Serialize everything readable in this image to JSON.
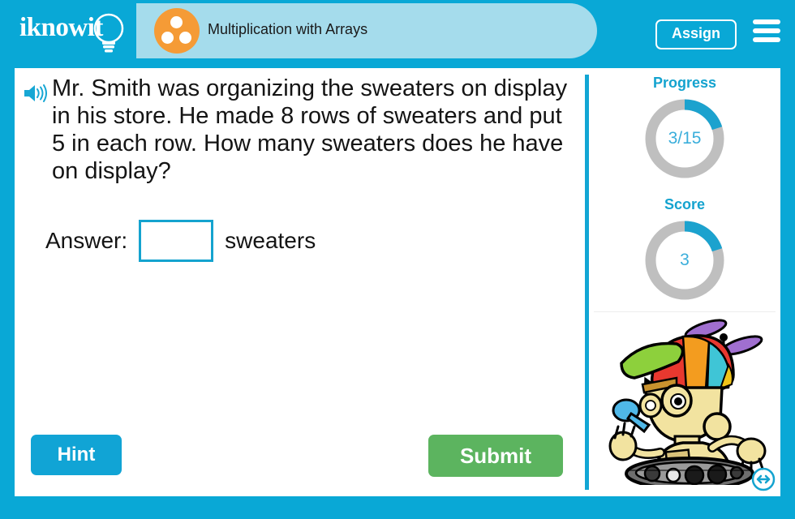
{
  "header": {
    "logo_text": "iknowit",
    "logo_icon": "lightbulb-icon",
    "subject_icon": "three-dots-array-icon",
    "lesson_title": "Multiplication with Arrays",
    "assign_label": "Assign",
    "menu_icon": "hamburger-menu-icon"
  },
  "question": {
    "audio_icon": "speaker-icon",
    "text": "Mr. Smith was organizing the sweaters on display in his store. He made 8 rows of sweaters and put 5 in each row. How many sweaters does he have on display?",
    "answer_label": "Answer:",
    "answer_value": "",
    "answer_placeholder": "",
    "answer_unit": "sweaters"
  },
  "actions": {
    "hint_label": "Hint",
    "submit_label": "Submit"
  },
  "side_panel": {
    "progress": {
      "label": "Progress",
      "value_text": "3/15",
      "current": 3,
      "total": 15,
      "percent": 20
    },
    "score": {
      "label": "Score",
      "value_text": "3",
      "current": 3,
      "percent": 20
    },
    "mascot_icon": "robot-mascot-icon",
    "resize_icon": "horizontal-resize-icon"
  },
  "colors": {
    "brand_cyan": "#09A8D6",
    "title_band": "#A5DCEC",
    "accent_orange": "#F59B36",
    "submit_green": "#5CB45F",
    "meter_track": "#BFBFBF",
    "meter_fill": "#1CA2CE",
    "input_border": "#14A3CF"
  }
}
